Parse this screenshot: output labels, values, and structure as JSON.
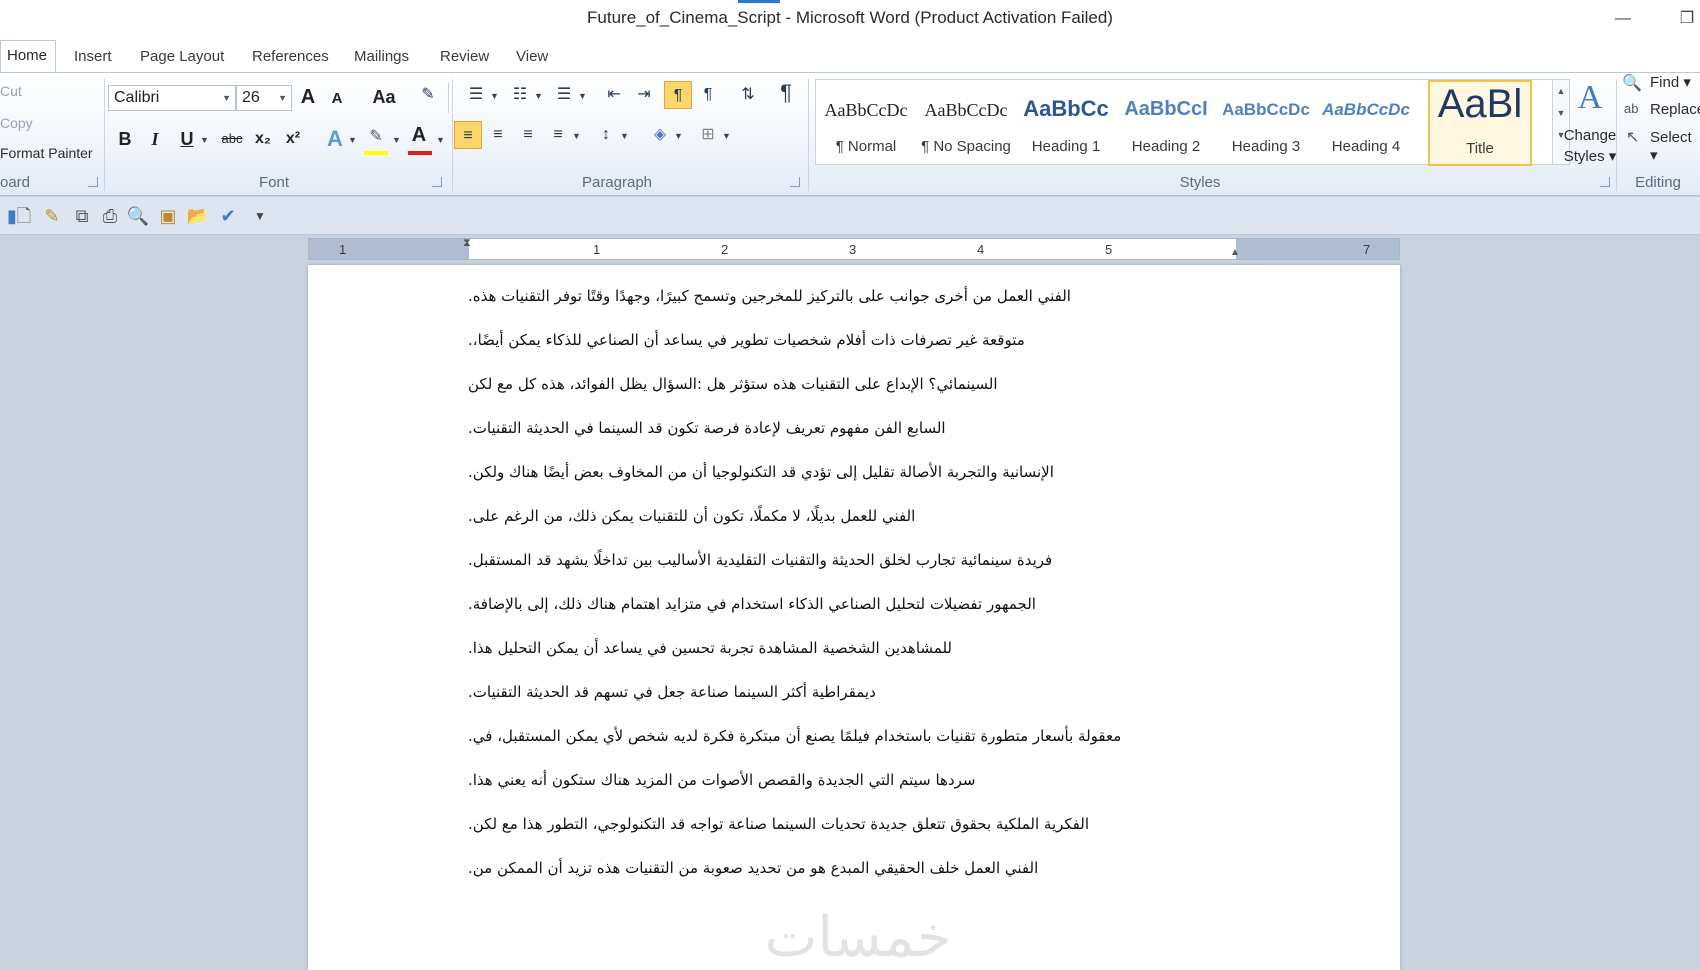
{
  "window": {
    "title": "Future_of_Cinema_Script  -  Microsoft Word (Product Activation Failed)",
    "minimize_glyph": "—",
    "restore_glyph": "❐"
  },
  "tabs": [
    "Home",
    "Insert",
    "Page Layout",
    "References",
    "Mailings",
    "Review",
    "View"
  ],
  "clipboard": {
    "cut": "Cut",
    "copy": "Copy",
    "format_painter": "Format Painter",
    "label": "oard"
  },
  "font": {
    "name": "Calibri",
    "size": "26",
    "grow": "A",
    "shrink": "A",
    "change_case": "Aa",
    "bold": "B",
    "italic": "I",
    "underline": "U",
    "strikethrough": "abc",
    "subscript": "x₂",
    "superscript": "x²",
    "text_effects": "A",
    "font_color": "A",
    "label": "Font",
    "highlight_color": "#ffff00",
    "font_color_hex": "#e02020"
  },
  "paragraph": {
    "label": "Paragraph",
    "show_marks": "¶"
  },
  "styles": {
    "label": "Styles",
    "items": [
      {
        "sample": "AaBbCcDc",
        "name": "¶ Normal"
      },
      {
        "sample": "AaBbCcDc",
        "name": "¶ No Spacing"
      },
      {
        "sample": "AaBbCc",
        "name": "Heading 1"
      },
      {
        "sample": "AaBbCcI",
        "name": "Heading 2"
      },
      {
        "sample": "AaBbCcDc",
        "name": "Heading 3"
      },
      {
        "sample": "AaBbCcDc",
        "name": "Heading 4"
      },
      {
        "sample": "AaBl",
        "name": "Title"
      }
    ],
    "change_styles_1": "Change",
    "change_styles_2": "Styles ▾"
  },
  "editing": {
    "label": "Editing",
    "find": "Find ▾",
    "replace": "Replace",
    "select": "Select ▾"
  },
  "ruler": {
    "numbers": [
      "1",
      "1",
      "2",
      "3",
      "4",
      "5",
      "7"
    ]
  },
  "document": {
    "lines": [
      "الفني العمل من أخرى جوانب على بالتركيز للمخرجين وتسمح كبيرًا، وجهدًا وقتًا توفر التقنيات هذه.",
      "متوقعة غير تصرفات ذات أفلام شخصيات تطوير في يساعد أن الصناعي للذكاء يمكن أيضًا،.",
      "السينمائي؟ الإبداع على التقنيات هذه ستؤثر هل :السؤال يظل الفوائد، هذه كل مع لكن",
      "السابع الفن مفهوم تعريف لإعادة فرصة تكون قد السينما في الحديثة التقنيات.",
      "الإنسانية والتجربة الأصالة تقليل إلى تؤدي قد التكنولوجيا أن من المخاوف بعض أيضًا هناك ولكن.",
      "الفني للعمل بديلًا، لا مكملًا، تكون أن للتقنيات يمكن ذلك، من الرغم على.",
      "فريدة سينمائية تجارب لخلق الحديثة والتقنيات التقليدية الأساليب بين تداخلًا يشهد قد المستقبل.",
      "الجمهور تفضيلات لتحليل الصناعي الذكاء استخدام في متزايد اهتمام هناك ذلك، إلى بالإضافة.",
      "للمشاهدين الشخصية المشاهدة تجربة تحسين في يساعد أن يمكن التحليل هذا.",
      "ديمقراطية أكثر السينما صناعة جعل في تسهم قد الحديثة التقنيات.",
      "معقولة بأسعار متطورة تقنيات باستخدام فيلمًا يصنع أن مبتكرة فكرة لديه شخص لأي يمكن المستقبل، في.",
      "سردها سيتم التي الجديدة والقصص الأصوات من المزيد هناك ستكون أنه يعني هذا.",
      "الفكرية الملكية بحقوق تتعلق جديدة تحديات السينما صناعة تواجه قد التكنولوجي، التطور هذا مع لكن.",
      "الفني العمل خلف الحقيقي المبدع هو من تحديد صعوبة من التقنيات هذه تزيد أن الممكن من."
    ],
    "watermark": "خمسات"
  }
}
